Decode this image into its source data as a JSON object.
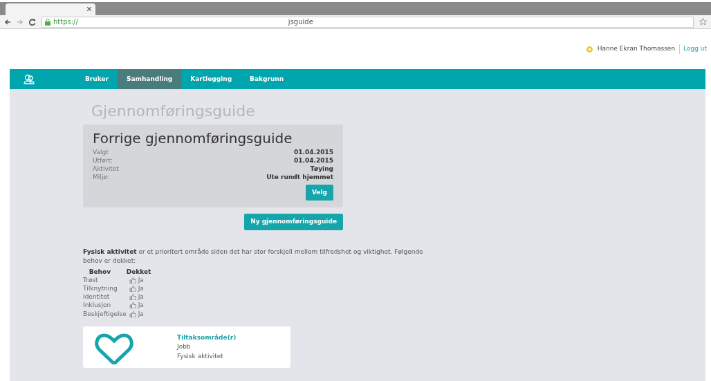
{
  "browser": {
    "url_scheme": "https://",
    "url_path": "jsguide"
  },
  "user": {
    "name": "Hanne Ekran Thomassen",
    "logout": "Logg ut"
  },
  "nav": [
    {
      "label": "Bruker",
      "selected": false
    },
    {
      "label": "Samhandling",
      "selected": true
    },
    {
      "label": "Kartlegging",
      "selected": false
    },
    {
      "label": "Bakgrunn",
      "selected": false
    }
  ],
  "page_title": "Gjennomføringsguide",
  "previous": {
    "title": "Forrige gjennomføringsguide",
    "rows": [
      {
        "label": "Valgt",
        "value": "01.04.2015"
      },
      {
        "label": "Utført:",
        "value": "01.04.2015"
      },
      {
        "label": "Aktivitet",
        "value": "Tøying"
      },
      {
        "label": "Miljø:",
        "value": "Ute rundt hjemmet"
      }
    ],
    "button": "Velg"
  },
  "new_button": "Ny gjennomføringsguide",
  "intro": "**Fysisk aktivitet** er et prioritert område siden det har stor forskjell mellom tilfredshet og viktighet. Følgende behov er dekket:",
  "needs": {
    "columns": [
      "Behov",
      "Dekket"
    ],
    "rows": [
      {
        "need": "Trøst",
        "covered": "Ja"
      },
      {
        "need": "Tilknytning",
        "covered": "Ja"
      },
      {
        "need": "Identitet",
        "covered": "Ja"
      },
      {
        "need": "Inklusjon",
        "covered": "Ja"
      },
      {
        "need": "Beskjeftigelse",
        "covered": "Ja"
      }
    ]
  },
  "measure_card": {
    "heading": "Tiltaksområde(r)",
    "items": [
      "Jobb",
      "Fysisk aktivitet"
    ]
  }
}
